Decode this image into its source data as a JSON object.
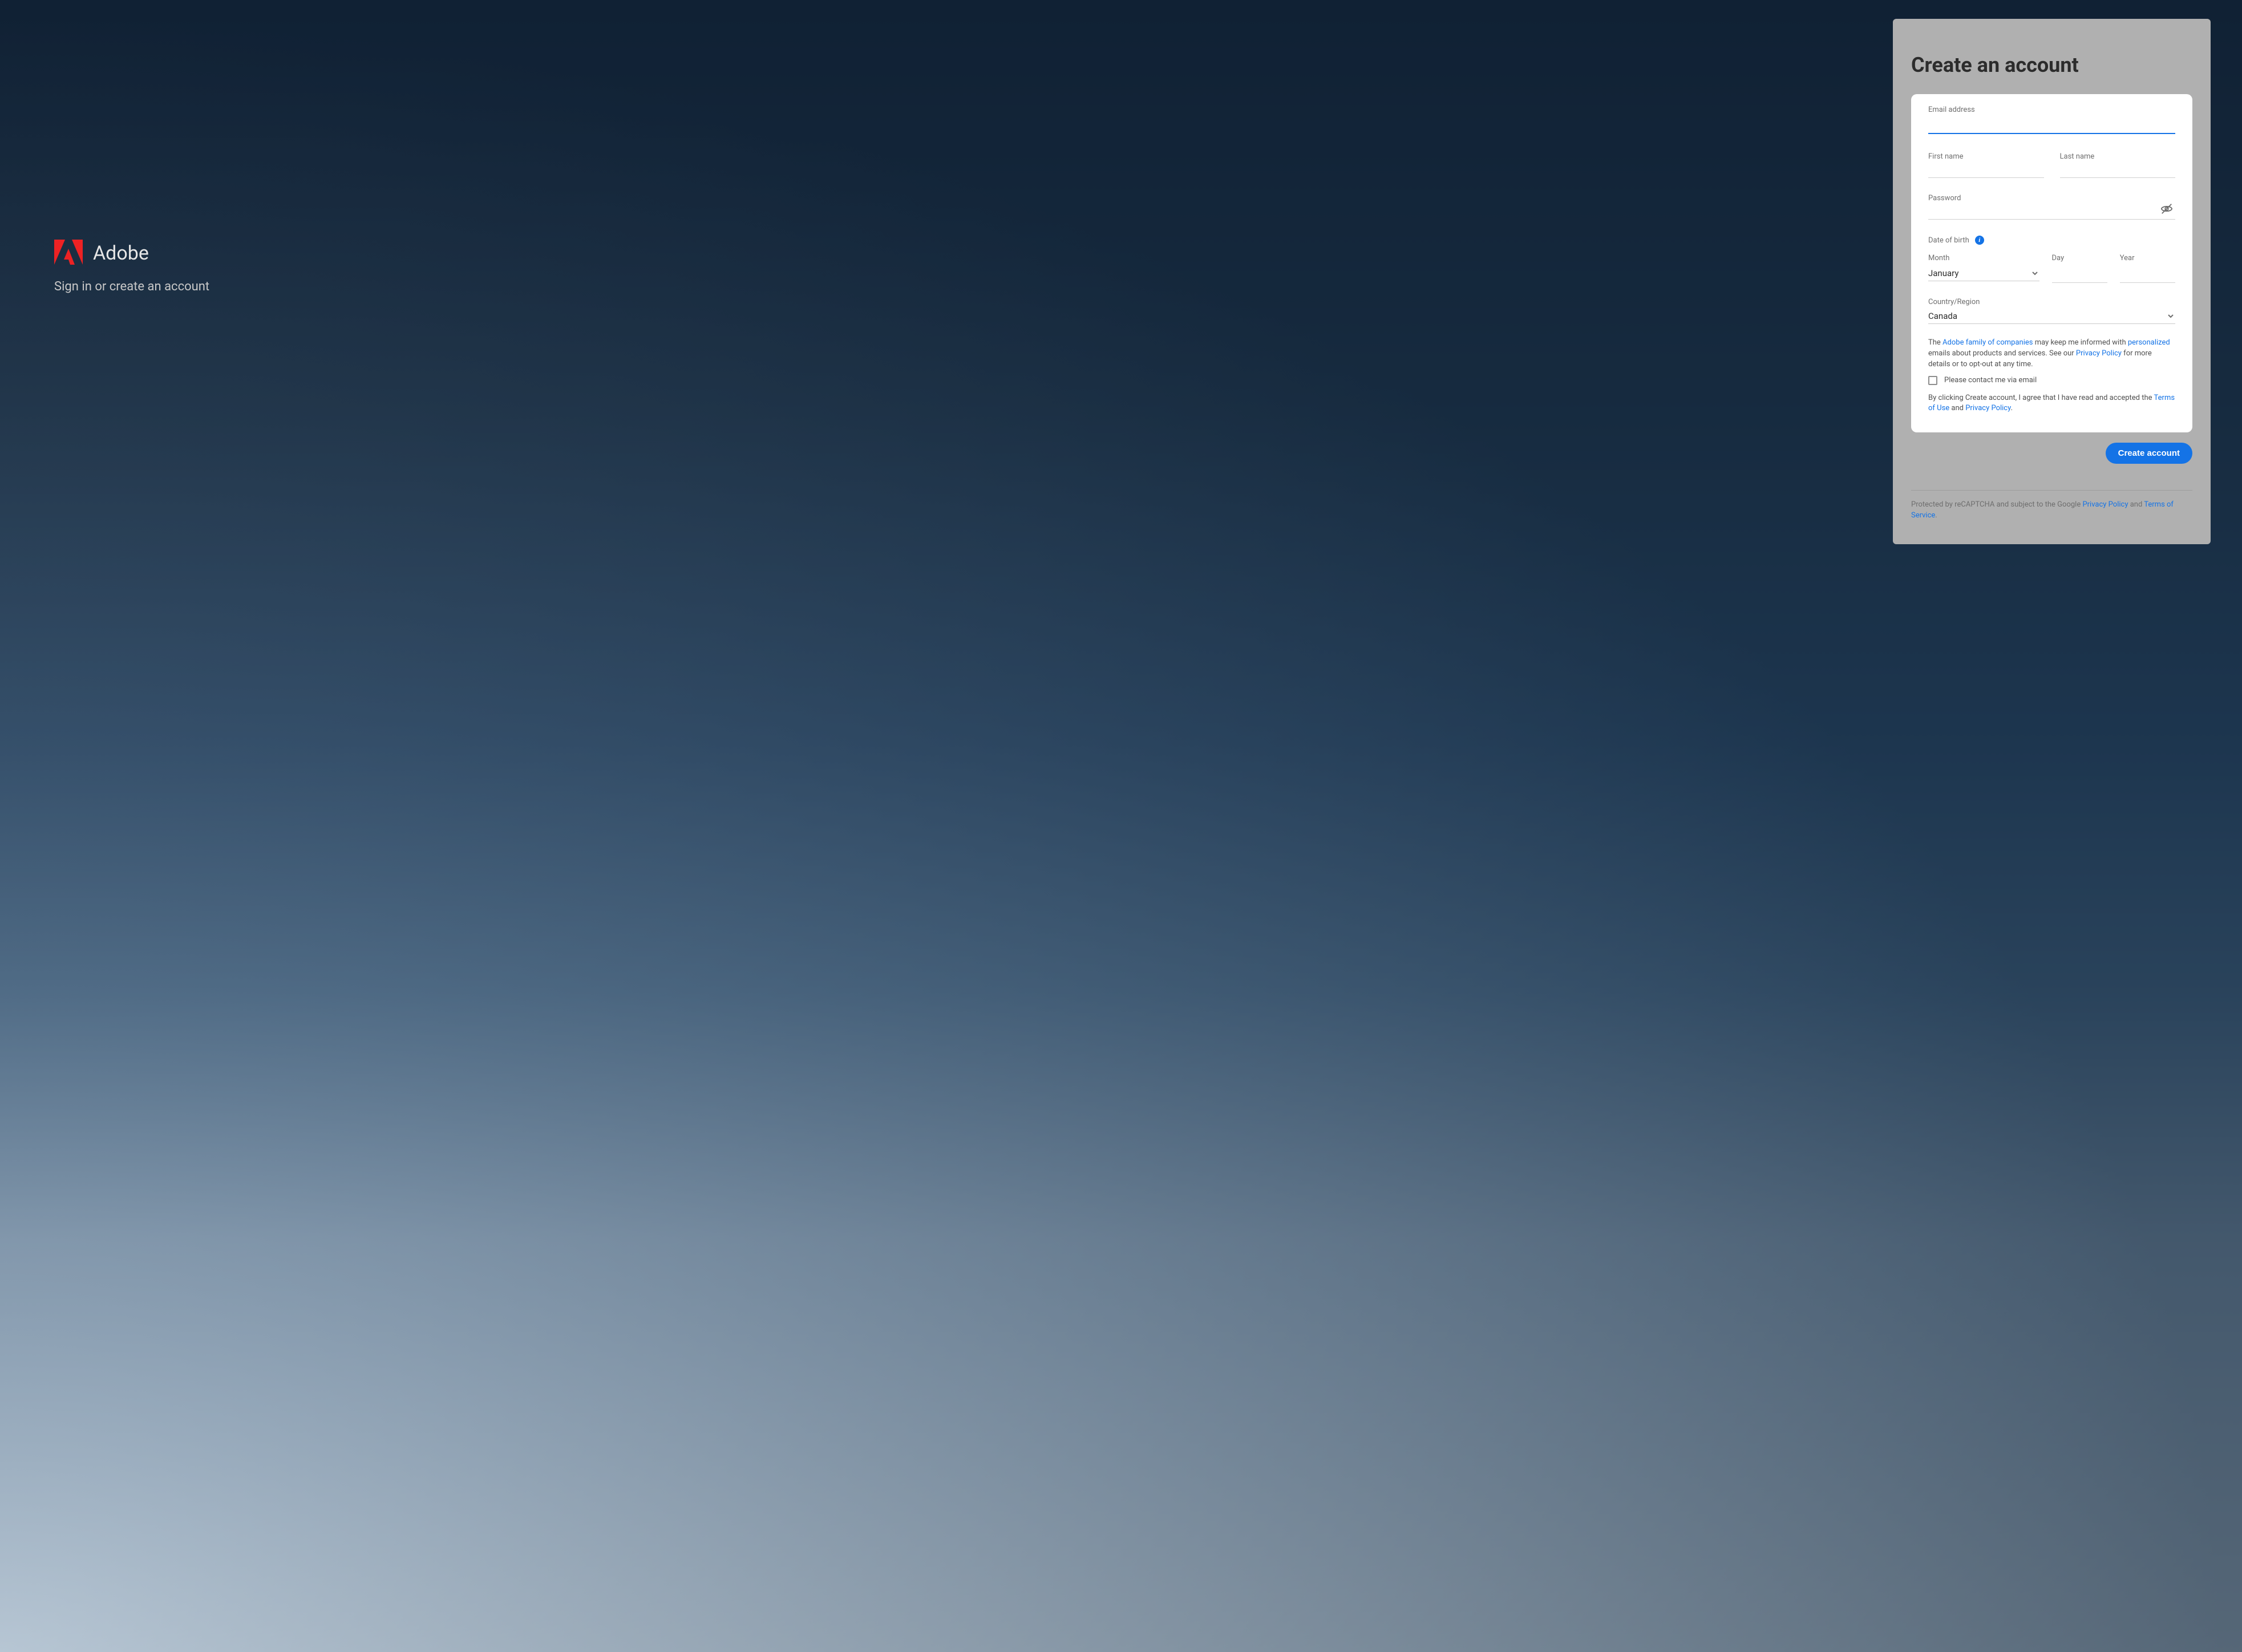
{
  "brand": {
    "name": "Adobe",
    "tagline": "Sign in or create an account"
  },
  "panel": {
    "title": "Create an account"
  },
  "form": {
    "email_label": "Email address",
    "email_value": "",
    "first_name_label": "First name",
    "first_name_value": "",
    "last_name_label": "Last name",
    "last_name_value": "",
    "password_label": "Password",
    "password_value": "",
    "dob_label": "Date of birth",
    "month_label": "Month",
    "month_value": "January",
    "day_label": "Day",
    "day_value": "",
    "year_label": "Year",
    "year_value": "",
    "region_label": "Country/Region",
    "region_value": "Canada"
  },
  "legal": {
    "p1_a": "The ",
    "p1_link1": "Adobe family of companies",
    "p1_b": " may keep me informed with ",
    "p1_link2": "personalized",
    "p1_c": " emails about products and services. See our ",
    "p1_link3": "Privacy Policy",
    "p1_d": " for more details or to opt-out at any time.",
    "checkbox_label": "Please contact me via email",
    "p2_a": "By clicking Create account, I agree that I have read and accepted the ",
    "p2_link1": "Terms of Use",
    "p2_b": " and ",
    "p2_link2": "Privacy Policy",
    "p2_c": "."
  },
  "actions": {
    "create_label": "Create account"
  },
  "footer": {
    "a": "Protected by reCAPTCHA and subject to the Google ",
    "link1": "Privacy Policy",
    "b": " and ",
    "link2": "Terms of Service",
    "c": "."
  }
}
